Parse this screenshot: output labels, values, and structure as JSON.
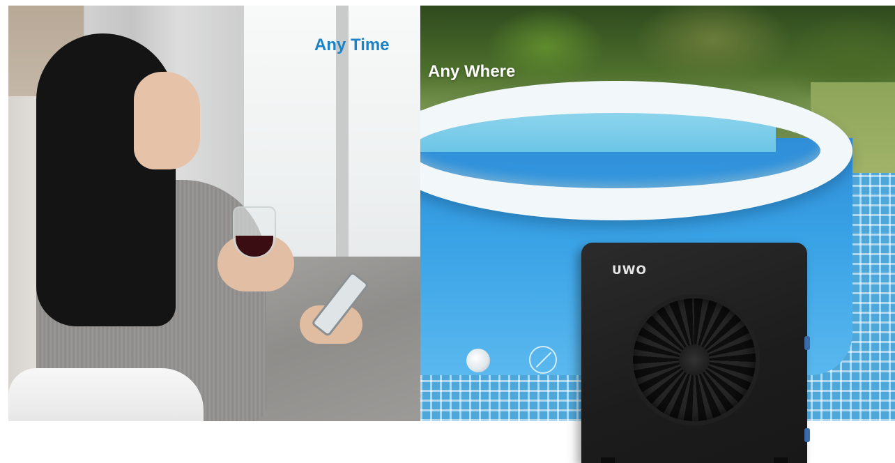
{
  "captions": {
    "any_time": "Any Time",
    "any_where": "Any Where"
  },
  "product": {
    "brand": "UWO"
  },
  "colors": {
    "accent_blue": "#1b82c5",
    "caption_white": "#ffffff",
    "unit_body": "#1f1f1f"
  },
  "icons": {
    "valve": "valve-icon",
    "no_sign": "warning-icon",
    "fan": "fan-icon"
  }
}
